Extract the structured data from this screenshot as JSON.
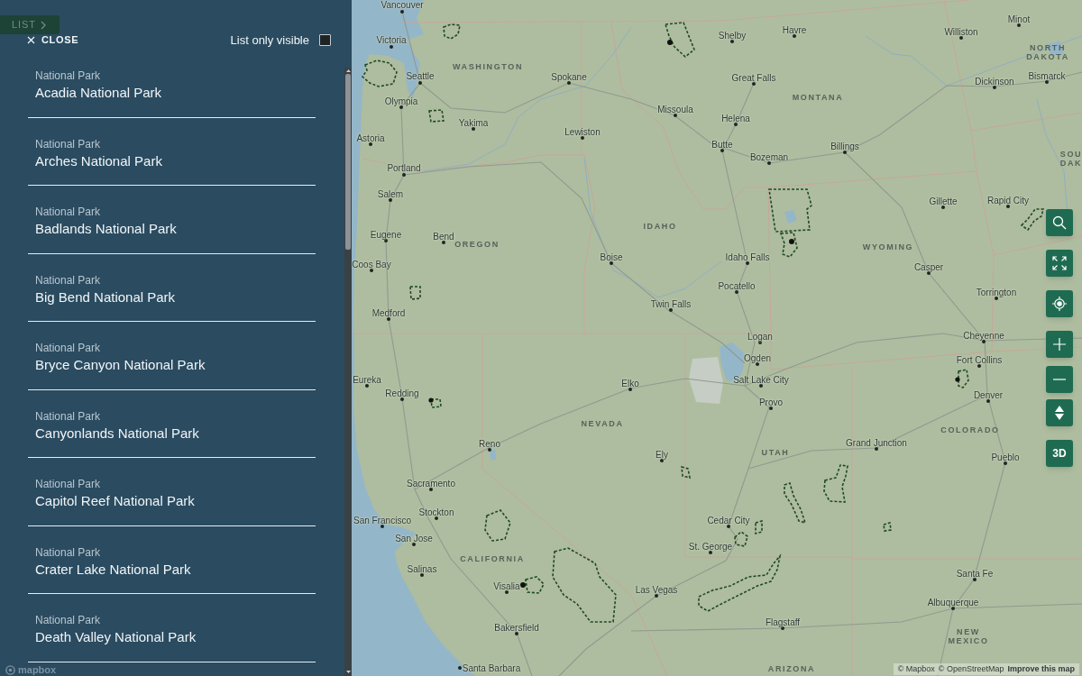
{
  "panel": {
    "list_tab": "LIST",
    "close_label": "CLOSE",
    "filter": {
      "label": "List only visible",
      "checked": false
    }
  },
  "parks": [
    {
      "category": "National Park",
      "name": "Acadia National Park"
    },
    {
      "category": "National Park",
      "name": "Arches National Park"
    },
    {
      "category": "National Park",
      "name": "Badlands National Park"
    },
    {
      "category": "National Park",
      "name": "Big Bend National Park"
    },
    {
      "category": "National Park",
      "name": "Bryce Canyon National Park"
    },
    {
      "category": "National Park",
      "name": "Canyonlands National Park"
    },
    {
      "category": "National Park",
      "name": "Capitol Reef National Park"
    },
    {
      "category": "National Park",
      "name": "Crater Lake National Park"
    },
    {
      "category": "National Park",
      "name": "Death Valley National Park"
    }
  ],
  "map": {
    "places": [
      {
        "name": "Vancouver",
        "kind": "city"
      },
      {
        "name": "Minot",
        "kind": "city"
      },
      {
        "name": "Victoria",
        "kind": "city"
      },
      {
        "name": "Shelby",
        "kind": "city"
      },
      {
        "name": "Havre",
        "kind": "city"
      },
      {
        "name": "Williston",
        "kind": "city"
      },
      {
        "name": "NORTH DAKOTA",
        "kind": "region"
      },
      {
        "name": "Seattle",
        "kind": "city"
      },
      {
        "name": "WASHINGTON",
        "kind": "region"
      },
      {
        "name": "Spokane",
        "kind": "city"
      },
      {
        "name": "Great Falls",
        "kind": "city"
      },
      {
        "name": "Dickinson",
        "kind": "city"
      },
      {
        "name": "Bismarck",
        "kind": "city"
      },
      {
        "name": "Olympia",
        "kind": "city"
      },
      {
        "name": "MONTANA",
        "kind": "region"
      },
      {
        "name": "Missoula",
        "kind": "city"
      },
      {
        "name": "Yakima",
        "kind": "city"
      },
      {
        "name": "Helena",
        "kind": "city"
      },
      {
        "name": "Astoria",
        "kind": "city"
      },
      {
        "name": "Lewiston",
        "kind": "city"
      },
      {
        "name": "Butte",
        "kind": "city"
      },
      {
        "name": "Billings",
        "kind": "city"
      },
      {
        "name": "Bozeman",
        "kind": "city"
      },
      {
        "name": "Portland",
        "kind": "city"
      },
      {
        "name": "SOU DAK",
        "kind": "region"
      },
      {
        "name": "Salem",
        "kind": "city"
      },
      {
        "name": "Gillette",
        "kind": "city"
      },
      {
        "name": "Rapid City",
        "kind": "city"
      },
      {
        "name": "Eugene",
        "kind": "city"
      },
      {
        "name": "Bend",
        "kind": "city"
      },
      {
        "name": "IDAHO",
        "kind": "region"
      },
      {
        "name": "OREGON",
        "kind": "region"
      },
      {
        "name": "WYOMING",
        "kind": "region"
      },
      {
        "name": "Coos Bay",
        "kind": "city"
      },
      {
        "name": "Boise",
        "kind": "city"
      },
      {
        "name": "Idaho Falls",
        "kind": "city"
      },
      {
        "name": "Casper",
        "kind": "city"
      },
      {
        "name": "Pocatello",
        "kind": "city"
      },
      {
        "name": "Torrington",
        "kind": "city"
      },
      {
        "name": "Medford",
        "kind": "city"
      },
      {
        "name": "Twin Falls",
        "kind": "city"
      },
      {
        "name": "Logan",
        "kind": "city"
      },
      {
        "name": "Cheyenne",
        "kind": "city"
      },
      {
        "name": "Ogden",
        "kind": "city"
      },
      {
        "name": "Fort Collins",
        "kind": "city"
      },
      {
        "name": "Eureka",
        "kind": "city"
      },
      {
        "name": "Elko",
        "kind": "city"
      },
      {
        "name": "Salt Lake City",
        "kind": "city"
      },
      {
        "name": "Redding",
        "kind": "city"
      },
      {
        "name": "Provo",
        "kind": "city"
      },
      {
        "name": "Denver",
        "kind": "city"
      },
      {
        "name": "NEVADA",
        "kind": "region"
      },
      {
        "name": "COLORADO",
        "kind": "region"
      },
      {
        "name": "Reno",
        "kind": "city"
      },
      {
        "name": "Grand Junction",
        "kind": "city"
      },
      {
        "name": "Ely",
        "kind": "city"
      },
      {
        "name": "UTAH",
        "kind": "region"
      },
      {
        "name": "Pueblo",
        "kind": "city"
      },
      {
        "name": "Sacramento",
        "kind": "city"
      },
      {
        "name": "San Francisco",
        "kind": "city"
      },
      {
        "name": "Stockton",
        "kind": "city"
      },
      {
        "name": "Cedar City",
        "kind": "city"
      },
      {
        "name": "San Jose",
        "kind": "city"
      },
      {
        "name": "St. George",
        "kind": "city"
      },
      {
        "name": "CALIFORNIA",
        "kind": "region"
      },
      {
        "name": "Salinas",
        "kind": "city"
      },
      {
        "name": "Santa Fe",
        "kind": "city"
      },
      {
        "name": "Visalia",
        "kind": "city"
      },
      {
        "name": "Las Vegas",
        "kind": "city"
      },
      {
        "name": "Albuquerque",
        "kind": "city"
      },
      {
        "name": "Bakersfield",
        "kind": "city"
      },
      {
        "name": "Flagstaff",
        "kind": "city"
      },
      {
        "name": "NEW MEXICO",
        "kind": "region"
      },
      {
        "name": "Santa Barbara",
        "kind": "city"
      },
      {
        "name": "ARIZONA",
        "kind": "region"
      }
    ],
    "toggle_3d_label": "3D",
    "logo_text": "mapbox",
    "attribution": [
      "© Mapbox",
      "© OpenStreetMap"
    ],
    "improve_link": "Improve this map"
  }
}
